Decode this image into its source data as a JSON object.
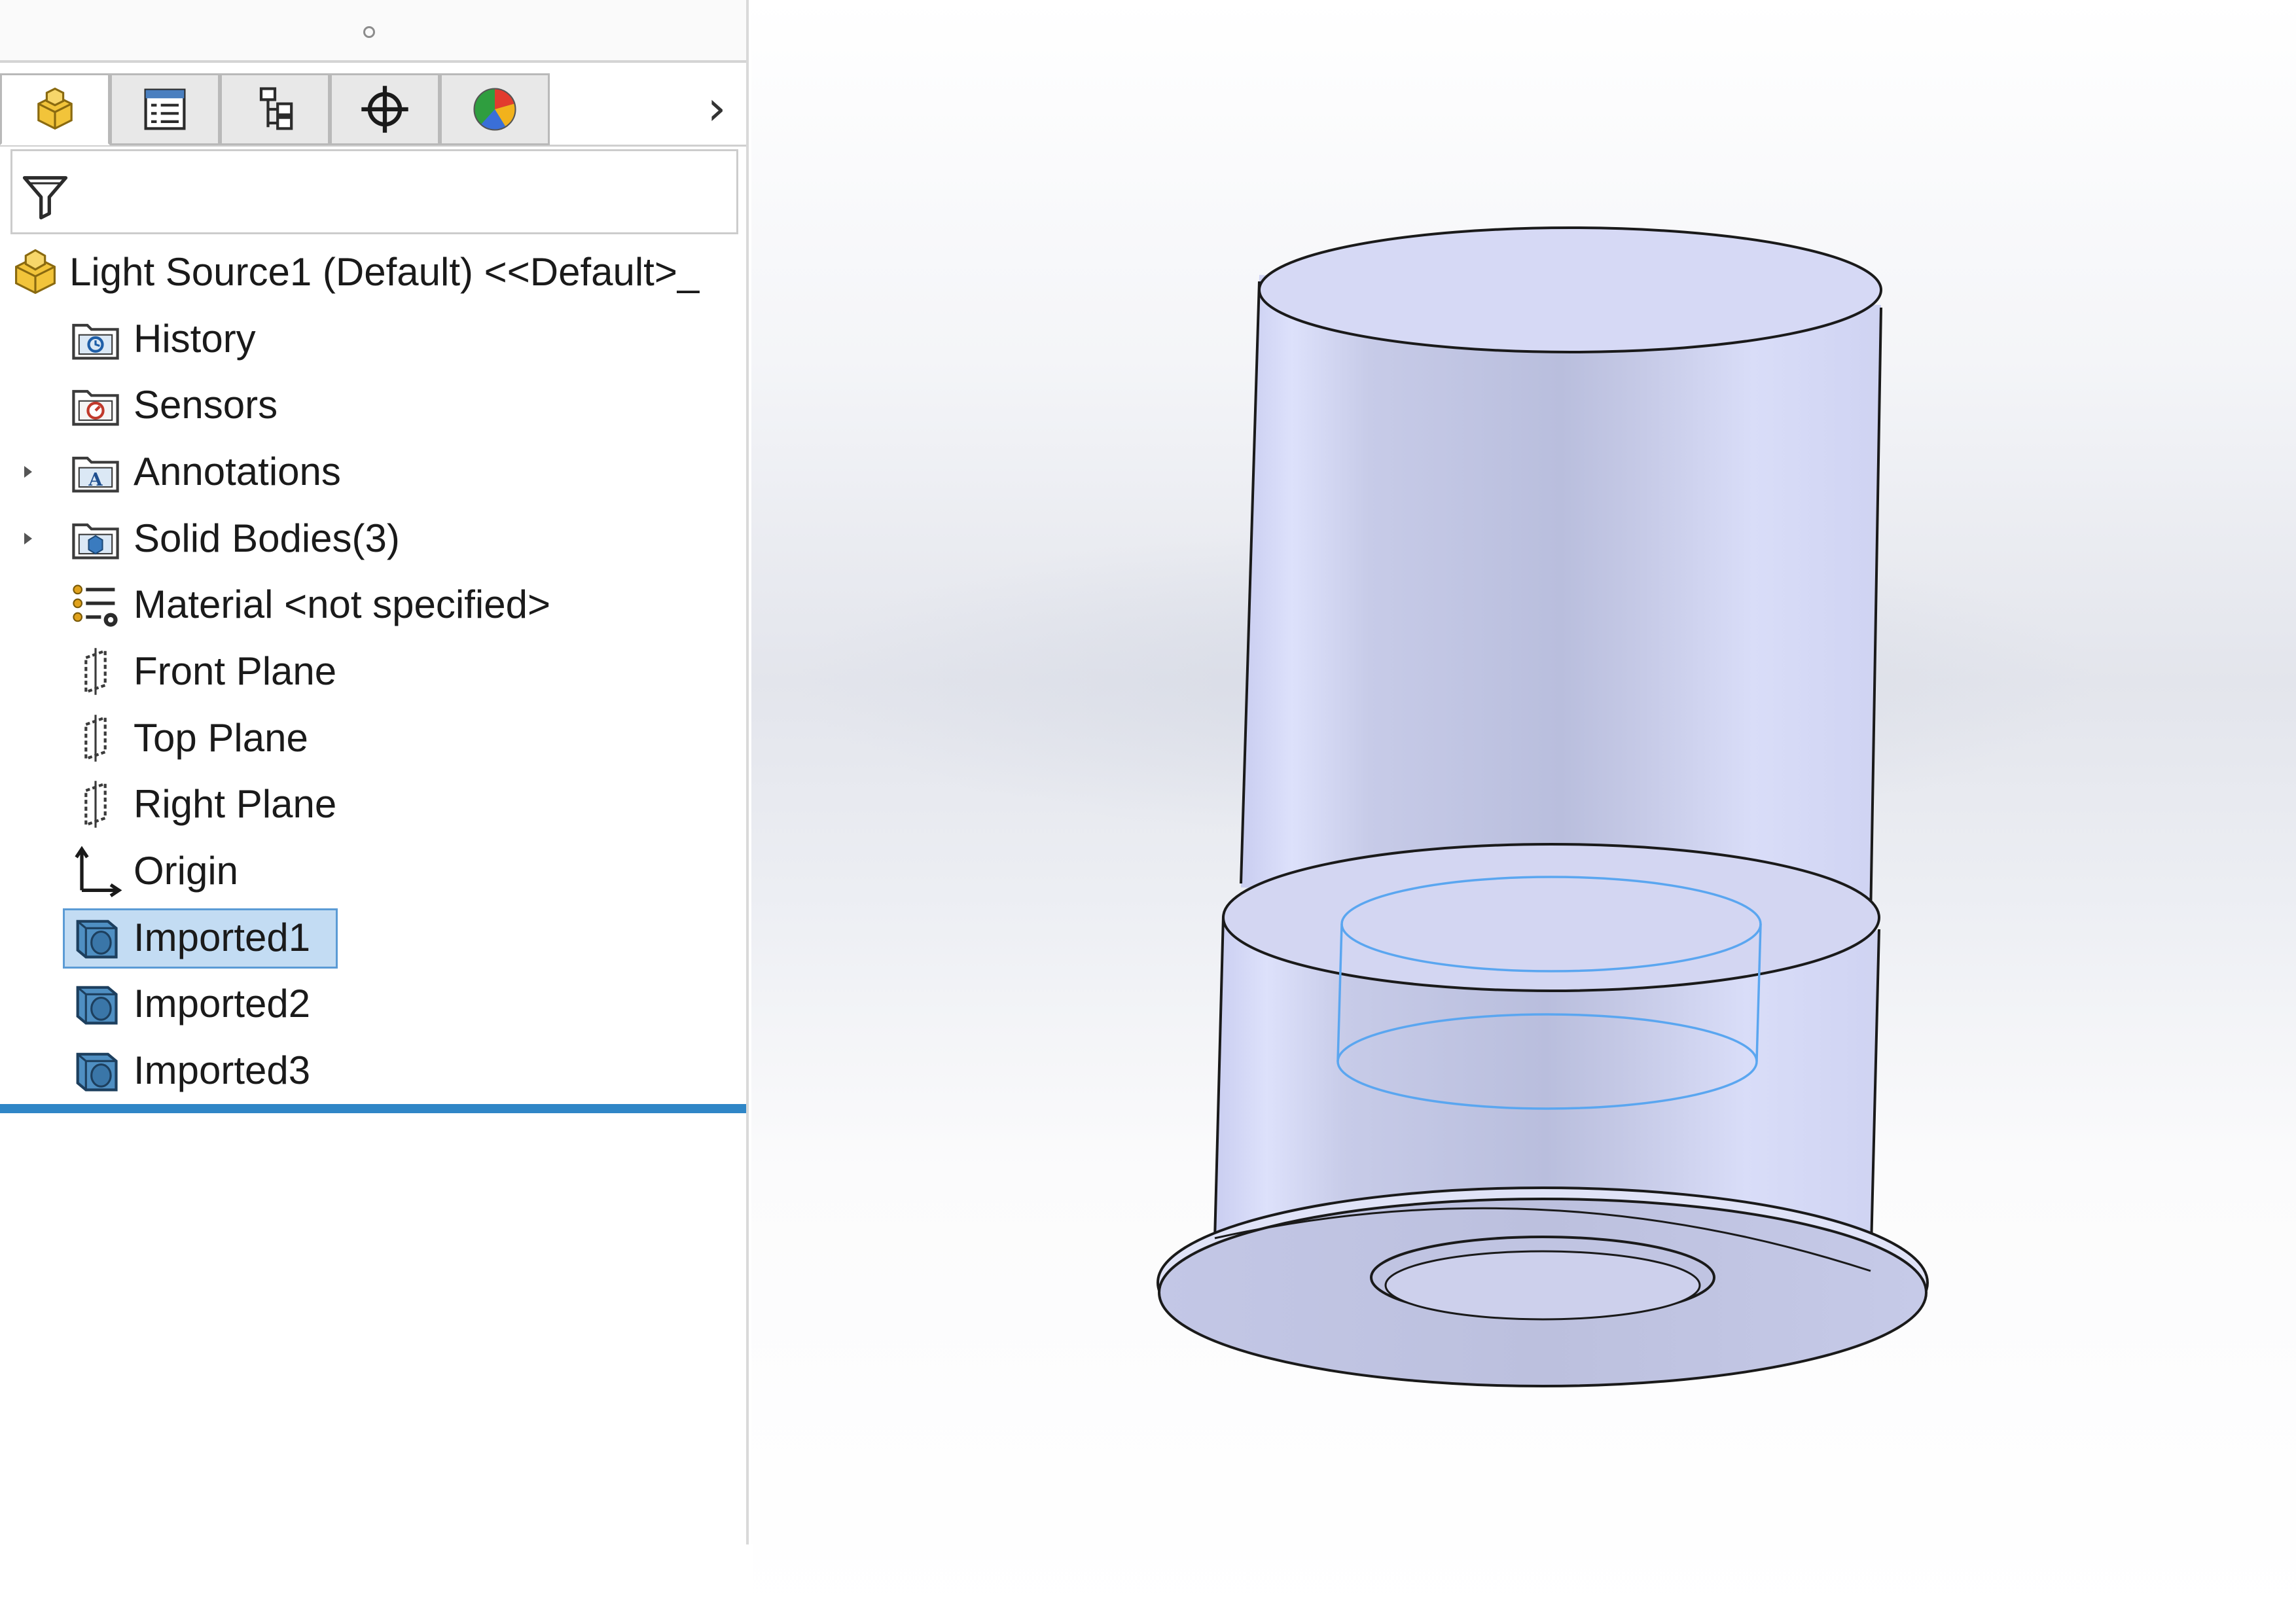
{
  "feature_manager": {
    "tabs": [
      {
        "name": "featuremanager-tab",
        "icon": "part-icon"
      },
      {
        "name": "propertymanager-tab",
        "icon": "property-list-icon"
      },
      {
        "name": "configurationmanager-tab",
        "icon": "configuration-icon"
      },
      {
        "name": "dimxpertmanager-tab",
        "icon": "crosshair-icon"
      },
      {
        "name": "displaymanager-tab",
        "icon": "display-pie-icon"
      }
    ],
    "more_tabs_glyph": "›",
    "tree": {
      "root_label": "Light Source1 (Default) <<Default>_",
      "items": [
        {
          "label": "History",
          "icon": "history-folder-icon",
          "expandable": false
        },
        {
          "label": "Sensors",
          "icon": "sensors-folder-icon",
          "expandable": false
        },
        {
          "label": "Annotations",
          "icon": "annotations-folder-icon",
          "expandable": true
        },
        {
          "label": "Solid Bodies(3)",
          "icon": "solid-bodies-folder-icon",
          "expandable": true
        },
        {
          "label": "Material <not specified>",
          "icon": "material-icon",
          "expandable": false
        },
        {
          "label": "Front Plane",
          "icon": "plane-icon",
          "expandable": false
        },
        {
          "label": "Top Plane",
          "icon": "plane-icon",
          "expandable": false
        },
        {
          "label": "Right Plane",
          "icon": "plane-icon",
          "expandable": false
        },
        {
          "label": "Origin",
          "icon": "origin-icon",
          "expandable": false
        },
        {
          "label": "Imported1",
          "icon": "imported-body-icon",
          "expandable": false,
          "selected": true
        },
        {
          "label": "Imported2",
          "icon": "imported-body-icon",
          "expandable": false
        },
        {
          "label": "Imported3",
          "icon": "imported-body-icon",
          "expandable": false
        }
      ]
    }
  },
  "colors": {
    "selection_fill": "#c3dcf3",
    "selection_border": "#5b9bd5",
    "rollback_bar": "#2f86c7",
    "model_face": "#c6cbea",
    "edge_highlight": "#5aa6f0"
  }
}
